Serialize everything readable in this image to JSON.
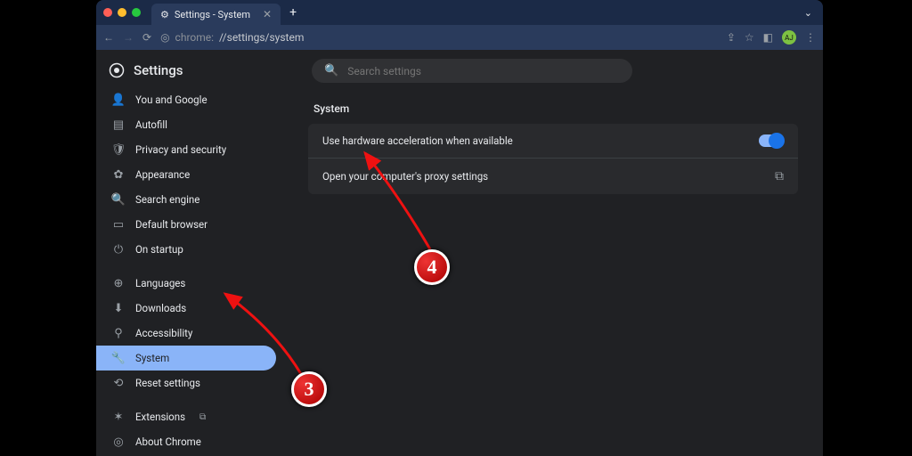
{
  "browser": {
    "tab_title": "Settings - System",
    "url_prefix": "chrome:",
    "url_path_mid": "//settings/",
    "url_path_last": "system",
    "avatar_initials": "AJ"
  },
  "header": {
    "title": "Settings",
    "search_placeholder": "Search settings"
  },
  "sidebar": {
    "items": [
      {
        "label": "You and Google",
        "icon": "person-icon",
        "glyph": "👤"
      },
      {
        "label": "Autofill",
        "icon": "autofill-icon",
        "glyph": "▤"
      },
      {
        "label": "Privacy and security",
        "icon": "shield-icon",
        "glyph": "🛡"
      },
      {
        "label": "Appearance",
        "icon": "appearance-icon",
        "glyph": "✿"
      },
      {
        "label": "Search engine",
        "icon": "search-icon",
        "glyph": "🔍"
      },
      {
        "label": "Default browser",
        "icon": "browser-icon",
        "glyph": "▭"
      },
      {
        "label": "On startup",
        "icon": "power-icon",
        "glyph": "⏻"
      }
    ],
    "items2": [
      {
        "label": "Languages",
        "icon": "globe-icon",
        "glyph": "⊕"
      },
      {
        "label": "Downloads",
        "icon": "download-icon",
        "glyph": "⬇"
      },
      {
        "label": "Accessibility",
        "icon": "accessibility-icon",
        "glyph": "⚲"
      },
      {
        "label": "System",
        "icon": "wrench-icon",
        "glyph": "🔧",
        "active": true
      },
      {
        "label": "Reset settings",
        "icon": "reset-icon",
        "glyph": "⟲"
      }
    ],
    "items3": [
      {
        "label": "Extensions",
        "icon": "puzzle-icon",
        "glyph": "✶",
        "ext": true
      },
      {
        "label": "About Chrome",
        "icon": "chrome-icon",
        "glyph": "◎"
      }
    ]
  },
  "main": {
    "section_title": "System",
    "rows": [
      {
        "label": "Use hardware acceleration when available",
        "type": "toggle",
        "on": true
      },
      {
        "label": "Open your computer's proxy settings",
        "type": "link"
      }
    ]
  },
  "annotations": {
    "badge3": "3",
    "badge4": "4"
  }
}
